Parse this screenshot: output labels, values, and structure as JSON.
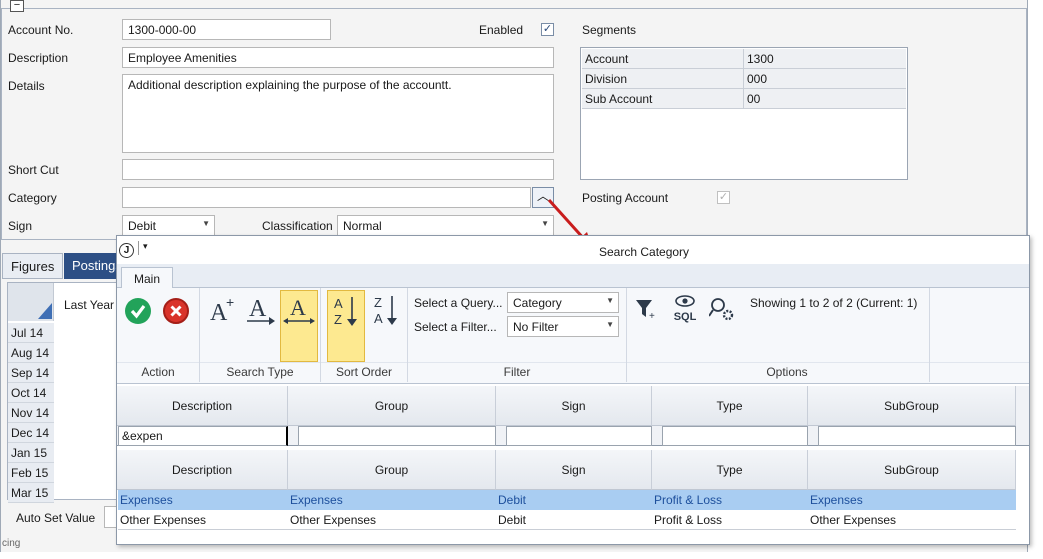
{
  "form": {
    "account_no_label": "Account No.",
    "account_no_value": "1300-000-00",
    "enabled_label": "Enabled",
    "description_label": "Description",
    "description_value": "Employee Amenities",
    "details_label": "Details",
    "details_value": "Additional description explaining the purpose of the accountt.",
    "shortcut_label": "Short Cut",
    "category_label": "Category",
    "sign_label": "Sign",
    "sign_value": "Debit",
    "classification_label": "Classification",
    "classification_value": "Normal",
    "segments_label": "Segments",
    "posting_account_label": "Posting Account",
    "collapse_glyph": "−"
  },
  "segments": [
    {
      "name": "Account",
      "value": "1300"
    },
    {
      "name": "Division",
      "value": "000"
    },
    {
      "name": "Sub Account",
      "value": "00"
    }
  ],
  "background": {
    "tab_figures": "Figures",
    "tab_postings": "Postings",
    "col_last_year": "Last Year C",
    "months": [
      "Jul 14",
      "Aug 14",
      "Sep 14",
      "Oct 14",
      "Nov 14",
      "Dec 14",
      "Jan 15",
      "Feb 15",
      "Mar 15"
    ],
    "auto_set_value": "Auto Set Value",
    "status_fragment": "cing"
  },
  "popup": {
    "title": "Search Category",
    "app_glyph": "J",
    "qat_glyph": "▾",
    "tab_main": "Main",
    "groups": {
      "action": "Action",
      "search_type": "Search Type",
      "sort_order": "Sort Order",
      "filter": "Filter",
      "options": "Options"
    },
    "select_query_label": "Select a Query...",
    "select_query_value": "Category",
    "select_filter_label": "Select a Filter...",
    "select_filter_value": "No Filter",
    "showing_text": "Showing 1 to 2 of 2 (Current: 1)",
    "sql_label": "SQL",
    "search_columns": [
      "Description",
      "Group",
      "Sign",
      "Type",
      "SubGroup"
    ],
    "search_filter_text": "&expen",
    "result_columns": [
      "Description",
      "Group",
      "Sign",
      "Type",
      "SubGroup"
    ],
    "rows": [
      {
        "description": "Expenses",
        "group": "Expenses",
        "sign": "Debit",
        "type": "Profit & Loss",
        "subgroup": "Expenses"
      },
      {
        "description": "Other Expenses",
        "group": "Other Expenses",
        "sign": "Debit",
        "type": "Profit & Loss",
        "subgroup": "Other Expenses"
      }
    ]
  },
  "colors": {
    "accept": "#22a35a",
    "cancel": "#d9342b",
    "selected_row": "#a9cdf2",
    "selected_text": "#1d4f9c",
    "active_button": "#fde990",
    "arrow": "#c91d1d"
  }
}
